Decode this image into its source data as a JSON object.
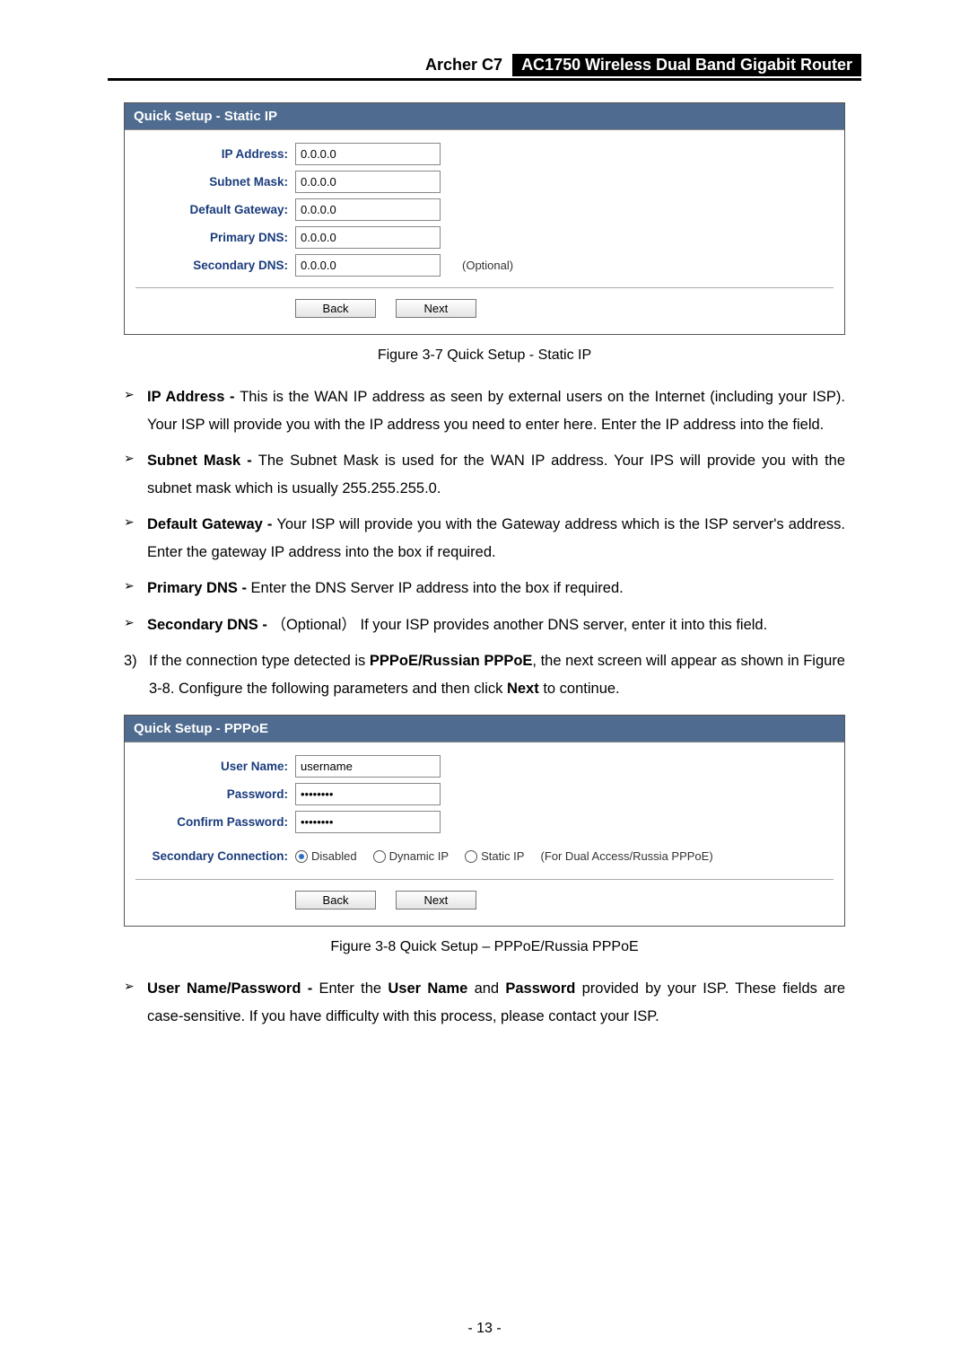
{
  "header": {
    "model": "Archer C7",
    "product": "AC1750 Wireless Dual Band Gigabit Router"
  },
  "panel_static": {
    "title": "Quick Setup - Static IP",
    "fields": {
      "ip_label": "IP Address:",
      "ip_value": "0.0.0.0",
      "subnet_label": "Subnet Mask:",
      "subnet_value": "0.0.0.0",
      "gateway_label": "Default Gateway:",
      "gateway_value": "0.0.0.0",
      "pdns_label": "Primary DNS:",
      "pdns_value": "0.0.0.0",
      "sdns_label": "Secondary DNS:",
      "sdns_value": "0.0.0.0",
      "optional": "(Optional)"
    },
    "back": "Back",
    "next": "Next"
  },
  "caption1": "Figure 3-7 Quick Setup - Static IP",
  "bullets1": {
    "ip_strong": "IP Address - ",
    "ip_text": "This is the WAN IP address as seen by external users on the Internet (including your ISP). Your ISP will provide you with the IP address you need to enter here. Enter the IP address into the field.",
    "subnet_strong": "Subnet Mask - ",
    "subnet_text": "The Subnet Mask is used for the WAN IP address. Your IPS will provide you with the subnet mask which is usually 255.255.255.0.",
    "gateway_strong": "Default Gateway - ",
    "gateway_text": "Your ISP will provide you with the Gateway address which is the ISP server's address. Enter the gateway IP address into the box if required.",
    "pdns_strong": "Primary DNS - ",
    "pdns_text": "Enter the DNS Server IP address into the box if required.",
    "sdns_strong": "Secondary DNS - ",
    "sdns_opt": "（Optional）",
    "sdns_text": " If your ISP provides another DNS server, enter it into this field."
  },
  "step3": {
    "num": "3)",
    "pre": "If the connection type detected is ",
    "strong": "PPPoE/Russian PPPoE",
    "mid": ", the next screen will appear as shown in Figure 3-8. Configure the following parameters and then click ",
    "next_strong": "Next",
    "tail": " to continue."
  },
  "panel_pppoe": {
    "title": "Quick Setup - PPPoE",
    "fields": {
      "user_label": "User Name:",
      "user_value": "username",
      "pwd_label": "Password:",
      "pwd_value": "••••••••",
      "cpwd_label": "Confirm Password:",
      "cpwd_value": "••••••••",
      "sec_label": "Secondary Connection:"
    },
    "radios": {
      "disabled": "Disabled",
      "dynamic": "Dynamic IP",
      "static": "Static IP",
      "note": "(For Dual Access/Russia PPPoE)"
    },
    "back": "Back",
    "next": "Next"
  },
  "caption2": "Figure 3-8 Quick Setup – PPPoE/Russia PPPoE",
  "bullets2": {
    "up_strong": "User Name/Password - ",
    "up_pre": "Enter the ",
    "up_user": "User Name",
    "up_and": " and ",
    "up_pwd": "Password",
    "up_text": " provided by your ISP. These fields are case-sensitive. If you have difficulty with this process, please contact your ISP."
  },
  "page_number": "- 13 -"
}
